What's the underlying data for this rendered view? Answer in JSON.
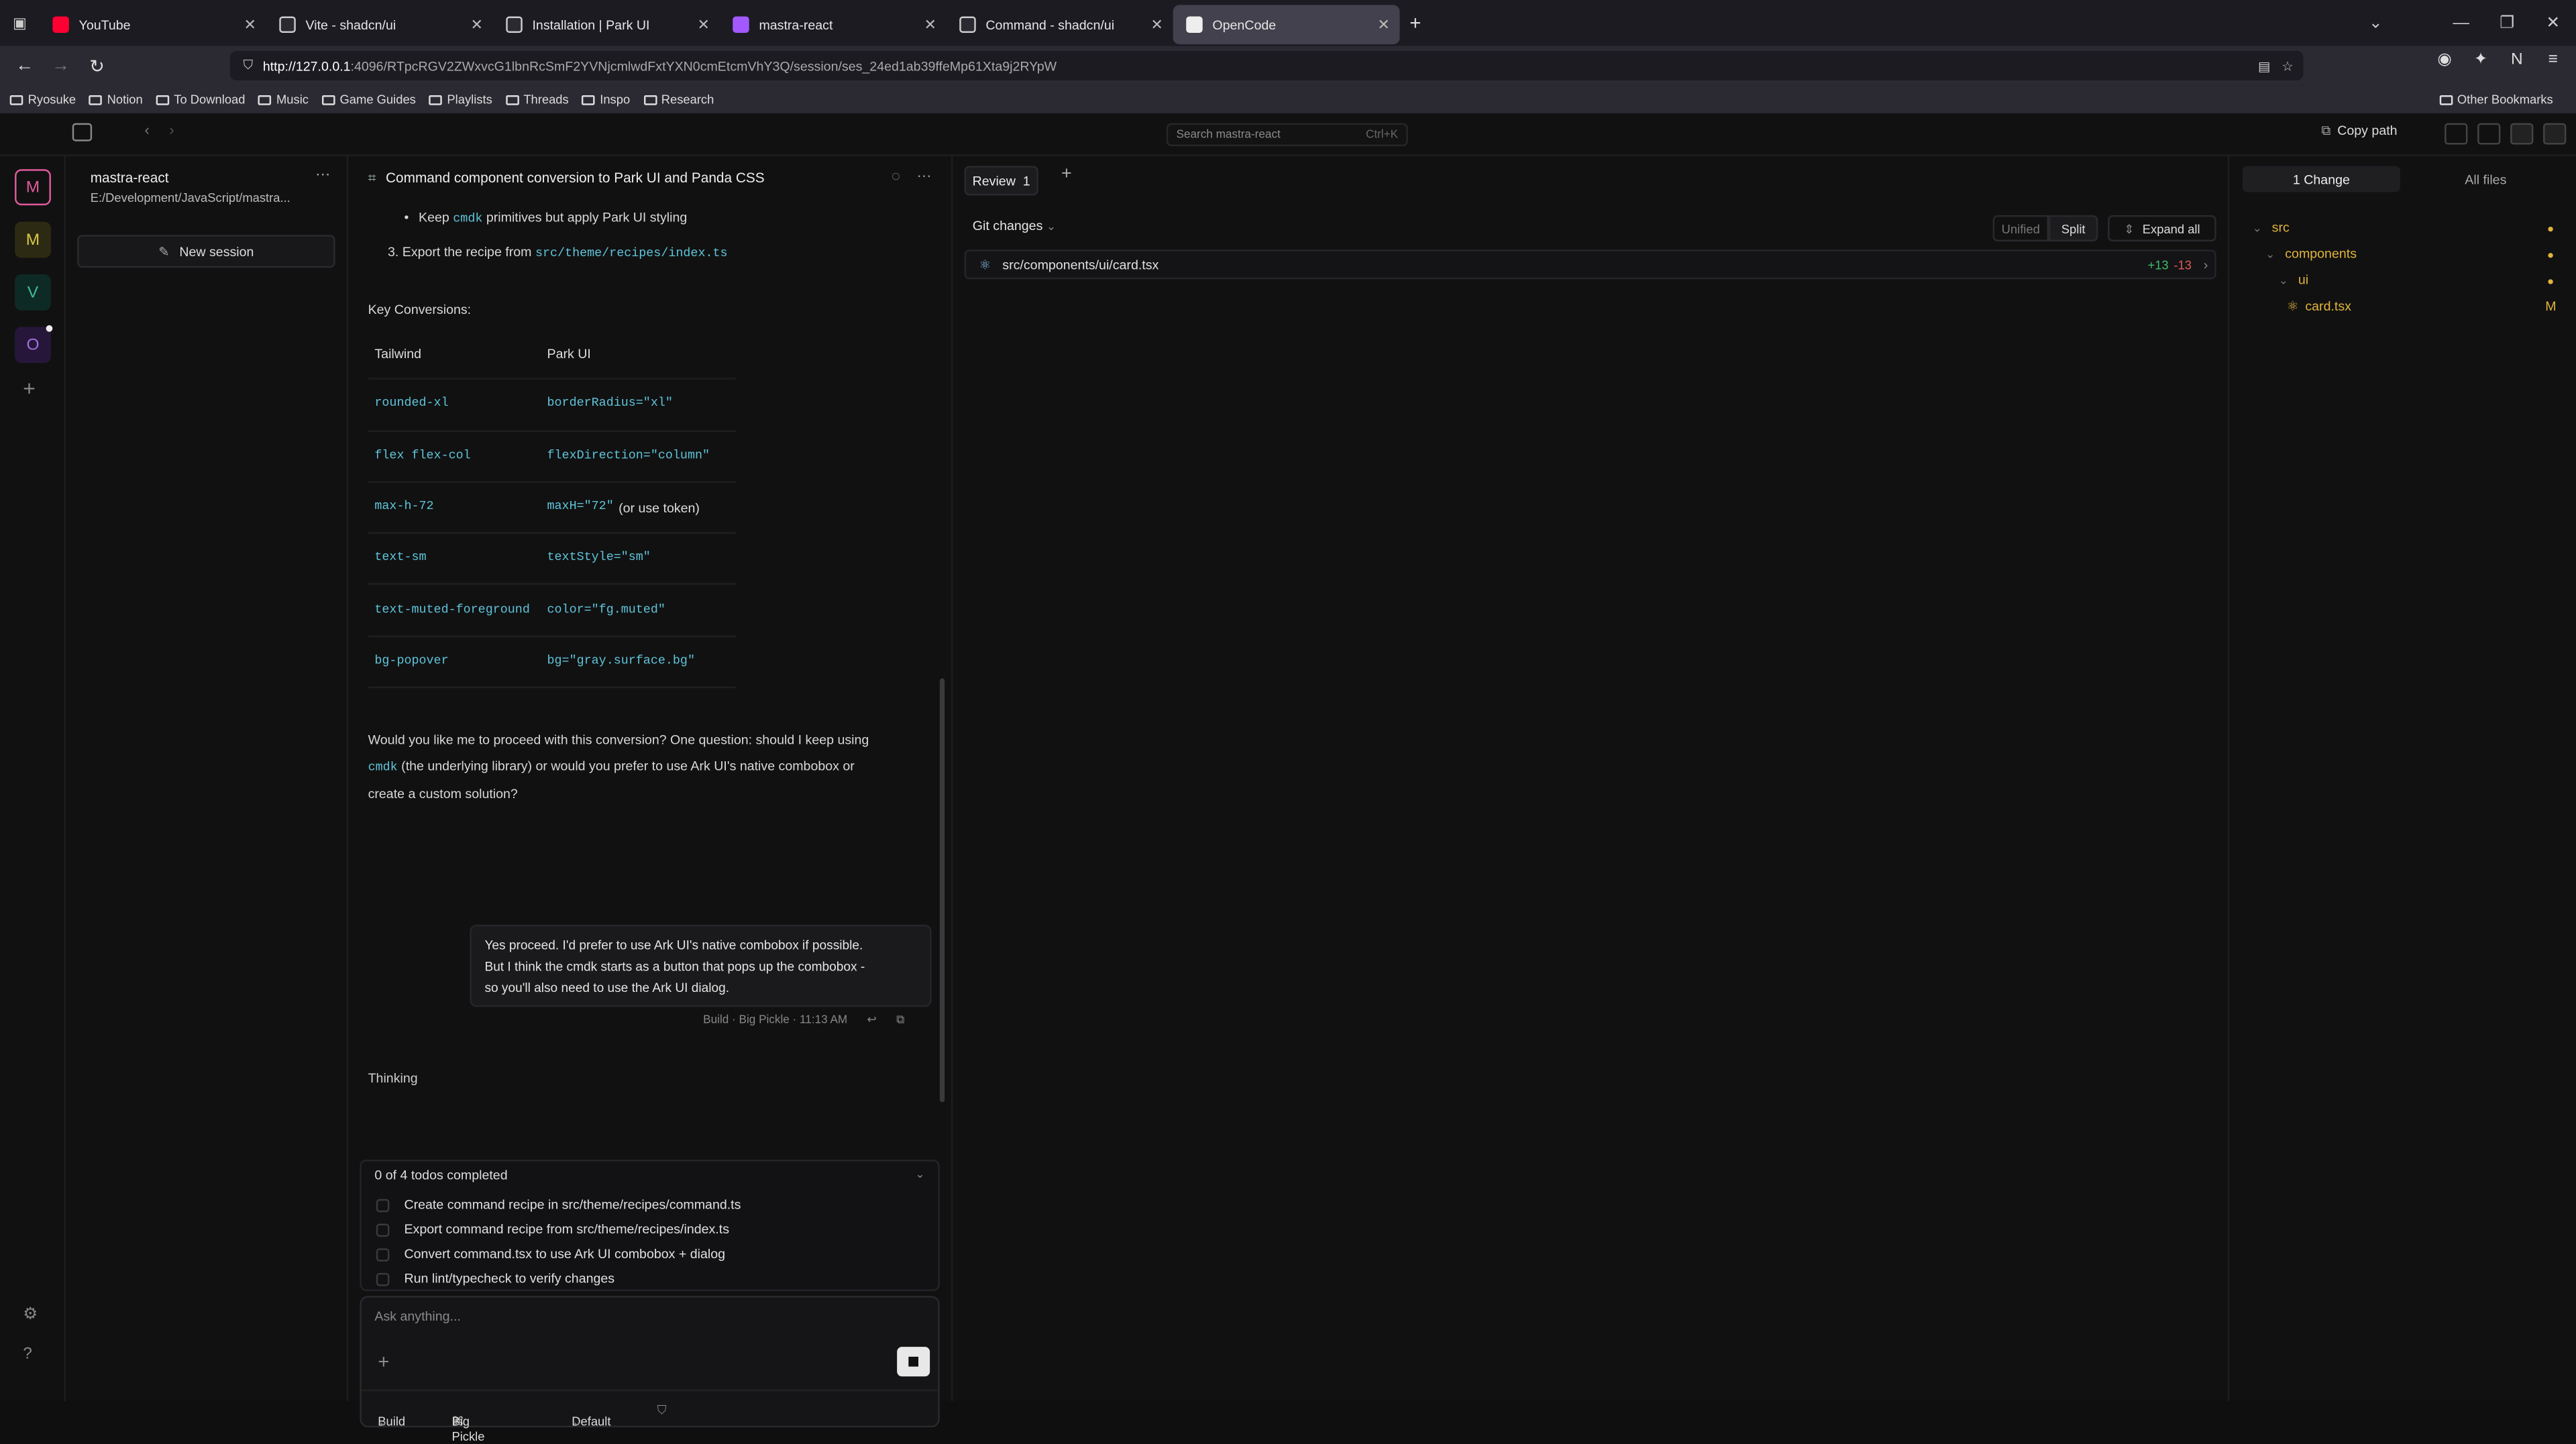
{
  "browser": {
    "tabs": [
      {
        "title": "YouTube",
        "color": "#ff0033"
      },
      {
        "title": "Vite - shadcn/ui",
        "color": "#cccccc"
      },
      {
        "title": "Installation | Park UI",
        "color": "#cccccc"
      },
      {
        "title": "mastra-react",
        "color": "#a259ff"
      },
      {
        "title": "Command - shadcn/ui",
        "color": "#cccccc"
      },
      {
        "title": "OpenCode",
        "color": "#eeeeee"
      }
    ],
    "url_host": "http://127.0.0.1",
    "url_rest": ":4096/RTpcRGV2ZWxvcG1lbnRcSmF2YVNjcmlwdFxtYXN0cmEtcmVhY3Q/session/ses_24ed1ab39ffeMp61Xta9j2RYpW",
    "bookmarks": [
      "Ryosuke",
      "Notion",
      "To Download",
      "Music",
      "Game Guides",
      "Playlists",
      "Threads",
      "Inspo",
      "Research"
    ],
    "other_bookmarks": "Other Bookmarks"
  },
  "app": {
    "search_placeholder": "Search mastra-react",
    "search_shortcut": "Ctrl+K",
    "copy_path": "Copy path",
    "projects": [
      {
        "letter": "M",
        "color": "#e05a9a",
        "bg": "#3a1830"
      },
      {
        "letter": "M",
        "color": "#d8c84a",
        "bg": "#2c2a12"
      },
      {
        "letter": "V",
        "color": "#3fbd9b",
        "bg": "#0e2a24"
      },
      {
        "letter": "O",
        "color": "#a070e0",
        "bg": "#26173a"
      }
    ]
  },
  "sidebar": {
    "project_name": "mastra-react",
    "project_path": "E:/Development/JavaScript/mastra...",
    "new_session": "New session"
  },
  "chat": {
    "title": "Command component conversion to Park UI and Panda CSS",
    "bullet_pre": "Keep",
    "bullet_code": "cmdk",
    "bullet_post": "primitives but apply Park UI styling",
    "step3_pre": "3.  Export the recipe from",
    "step3_code": "src/theme/recipes/index.ts",
    "key_conversions": "Key Conversions:",
    "table_head": [
      "Tailwind",
      "Park UI"
    ],
    "table_rows": [
      {
        "tw": "rounded-xl",
        "park": "borderRadius=\"xl\"",
        "note": ""
      },
      {
        "tw": "flex flex-col",
        "park": "flexDirection=\"column\"",
        "note": ""
      },
      {
        "tw": "max-h-72",
        "park": "maxH=\"72\"",
        "note": "(or use token)"
      },
      {
        "tw": "text-sm",
        "park": "textStyle=\"sm\"",
        "note": ""
      },
      {
        "tw": "text-muted-foreground",
        "park": "color=\"fg.muted\"",
        "note": ""
      },
      {
        "tw": "bg-popover",
        "park": "bg=\"gray.surface.bg\"",
        "note": ""
      }
    ],
    "question_l1": "Would you like me to proceed with this conversion? One question: should I keep using",
    "question_code": "cmdk",
    "question_l2": "(the underlying library) or would you prefer to use Ark UI's native combobox or",
    "question_l3": "create a custom solution?",
    "user_msg_l1": "Yes proceed. I'd prefer to use Ark UI's native combobox if possible.",
    "user_msg_l2": "But I think the cmdk starts as a button that pops up the combobox -",
    "user_msg_l3": "so you'll also need to use the Ark UI dialog.",
    "user_meta": "Build · Big Pickle · 11:13 AM",
    "thinking": "Thinking",
    "todos_header": "0 of 4 todos completed",
    "todos": [
      "Create command recipe in src/theme/recipes/command.ts",
      "Export command recipe from src/theme/recipes/index.ts",
      "Convert command.tsx to use Ark UI combobox + dialog",
      "Run lint/typecheck to verify changes"
    ],
    "composer_placeholder": "Ask anything...",
    "mode": "Build",
    "model": "Big Pickle",
    "variant": "Default"
  },
  "review": {
    "tab_label": "Review",
    "tab_count": "1",
    "git_changes": "Git changes",
    "view_unified": "Unified",
    "view_split": "Split",
    "expand_all": "Expand all",
    "file_path": "src/components/ui/card.tsx",
    "additions": "+13",
    "deletions": "-13"
  },
  "files": {
    "tab_changes": "1 Change",
    "tab_all": "All files",
    "tree": [
      "src",
      "components",
      "ui",
      "card.tsx"
    ],
    "modified_flag": "M"
  }
}
